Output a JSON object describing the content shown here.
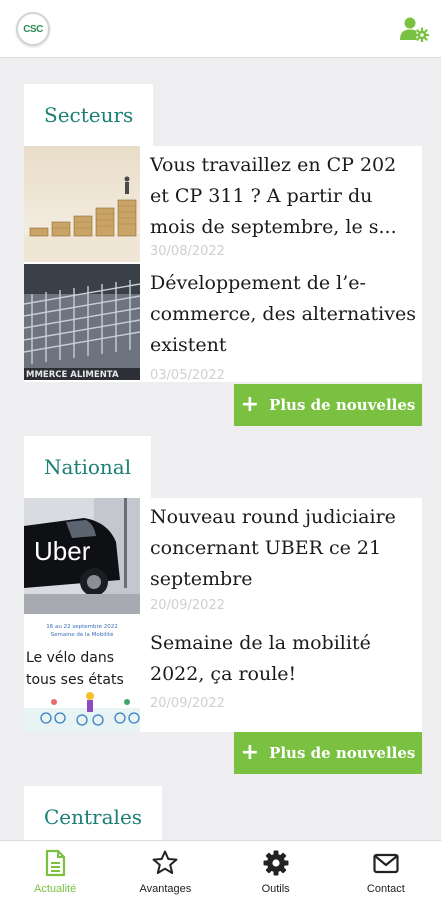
{
  "header": {
    "logo_text": "CSC",
    "profile_icon": "user-gear-icon"
  },
  "sections": [
    {
      "title": "Secteurs",
      "items": [
        {
          "title": "Vous travaillez en CP 202 et CP 311 ? A partir du mois de septembre, le s...",
          "date": "30/08/2022",
          "thumb": "coins"
        },
        {
          "title": "Développement de l’e-commerce, des alternatives existent",
          "date": "03/05/2022",
          "thumb": "carts"
        }
      ],
      "more_label": "Plus de nouvelles"
    },
    {
      "title": "National",
      "items": [
        {
          "title": "Nouveau round judiciaire concernant UBER ce 21 septembre",
          "date": "20/09/2022",
          "thumb": "uber"
        },
        {
          "title": "Semaine de la mobilité 2022, ça roule!",
          "date": "20/09/2022",
          "thumb": "velo"
        }
      ],
      "more_label": "Plus de nouvelles"
    },
    {
      "title": "Centrales"
    }
  ],
  "thumb_texts": {
    "carts_caption": "MMERCE ALIMENTA",
    "uber_text": "Uber",
    "velo_line1": "16 au 22 septembre 2022",
    "velo_line2": "Semaine de la Mobilité",
    "velo_main1": "Le vélo dans",
    "velo_main2": "tous ses états"
  },
  "bottom_nav": [
    {
      "label": "Actualité",
      "icon": "document-icon",
      "active": true
    },
    {
      "label": "Avantages",
      "icon": "star-icon",
      "active": false
    },
    {
      "label": "Outils",
      "icon": "gear-icon",
      "active": false
    },
    {
      "label": "Contact",
      "icon": "envelope-icon",
      "active": false
    }
  ],
  "colors": {
    "accent": "#7ac142",
    "section_title": "#1a7f74",
    "background": "#eeeef0"
  }
}
